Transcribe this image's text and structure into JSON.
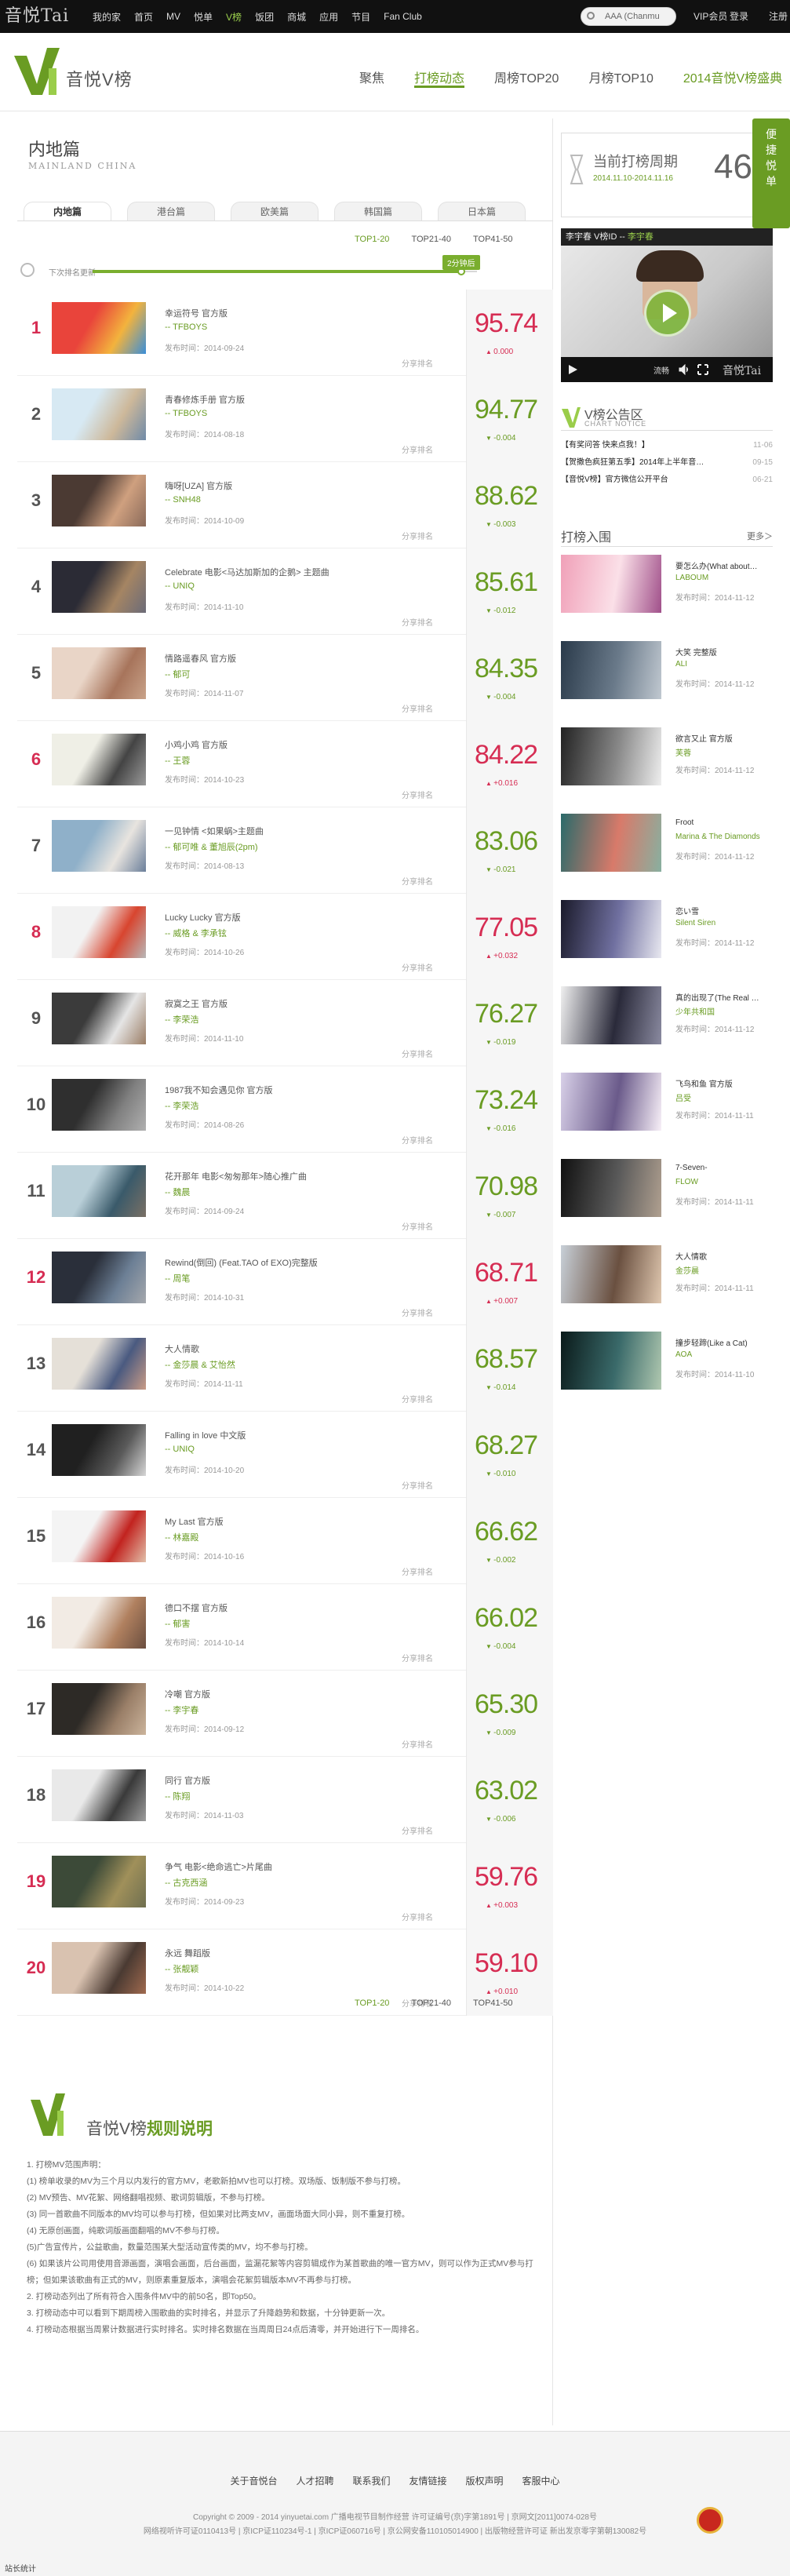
{
  "topbar": {
    "logo": "音悦Tai",
    "nav": [
      "我的家",
      "首页",
      "MV",
      "悦单",
      "V榜",
      "饭团",
      "商城",
      "应用",
      "节目",
      "Fan Club"
    ],
    "active": "V榜",
    "search_placeholder": "AAA (Chanmu",
    "vip": "VIP会员",
    "login": "登录",
    "register": "注册"
  },
  "header": {
    "title": "音悦V榜",
    "nav": [
      "聚焦",
      "打榜动态",
      "周榜TOP20",
      "月榜TOP10",
      "2014音悦V榜盛典"
    ],
    "active": "打榜动态"
  },
  "region": {
    "cn": "内地篇",
    "en": "MAINLAND CHINA"
  },
  "tabs": [
    "内地篇",
    "港台篇",
    "欧美篇",
    "韩国篇",
    "日本篇"
  ],
  "rank_tabs": [
    "TOP1-20",
    "TOP21-40",
    "TOP41-50"
  ],
  "countdown": {
    "label": "下次排名更新",
    "badge": "2分钟后",
    "progress": 0.96
  },
  "accent": "#6a9c23",
  "rise_color": "#d62d53",
  "chart": [
    {
      "rank": "1",
      "song": "幸运符号 官方版",
      "artist": "-- TFBOYS",
      "date": "发布时间：2014-09-24",
      "score": "95.74",
      "delta": "0.000",
      "dir": "up"
    },
    {
      "rank": "2",
      "song": "青春修炼手册 官方版",
      "artist": "-- TFBOYS",
      "date": "发布时间：2014-08-18",
      "score": "94.77",
      "delta": "-0.004",
      "dir": "down"
    },
    {
      "rank": "3",
      "song": "嗨呀[UZA] 官方版",
      "artist": "-- SNH48",
      "date": "发布时间：2014-10-09",
      "score": "88.62",
      "delta": "-0.003",
      "dir": "down"
    },
    {
      "rank": "4",
      "song": "Celebrate 电影<马达加斯加的企鹅> 主题曲",
      "artist": "-- UNIQ",
      "date": "发布时间：2014-11-10",
      "score": "85.61",
      "delta": "-0.012",
      "dir": "down"
    },
    {
      "rank": "5",
      "song": "情路遥春风 官方版",
      "artist": "-- 郁可",
      "date": "发布时间：2014-11-07",
      "score": "84.35",
      "delta": "-0.004",
      "dir": "down"
    },
    {
      "rank": "6",
      "song": "小鸡小鸡 官方版",
      "artist": "-- 王蓉",
      "date": "发布时间：2014-10-23",
      "score": "84.22",
      "delta": "+0.016",
      "dir": "up"
    },
    {
      "rank": "7",
      "song": "一见钟情 <如果蜗>主题曲",
      "artist": "-- 郁可唯 & 董旭辰(2pm)",
      "date": "发布时间：2014-08-13",
      "score": "83.06",
      "delta": "-0.021",
      "dir": "down"
    },
    {
      "rank": "8",
      "song": "Lucky Lucky 官方版",
      "artist": "-- 威格 & 李承铉",
      "date": "发布时间：2014-10-26",
      "score": "77.05",
      "delta": "+0.032",
      "dir": "up"
    },
    {
      "rank": "9",
      "song": "寂寞之王 官方版",
      "artist": "-- 李荣浩",
      "date": "发布时间：2014-11-10",
      "score": "76.27",
      "delta": "-0.019",
      "dir": "down"
    },
    {
      "rank": "10",
      "song": "1987我不知会遇见你 官方版",
      "artist": "-- 李荣浩",
      "date": "发布时间：2014-08-26",
      "score": "73.24",
      "delta": "-0.016",
      "dir": "down"
    },
    {
      "rank": "11",
      "song": "花开那年 电影<匆匆那年>随心推广曲",
      "artist": "-- 魏晨",
      "date": "发布时间：2014-09-24",
      "score": "70.98",
      "delta": "-0.007",
      "dir": "down"
    },
    {
      "rank": "12",
      "song": "Rewind(倒回) (Feat.TAO of EXO)完整版",
      "artist": "-- 周笔",
      "date": "发布时间：2014-10-31",
      "score": "68.71",
      "delta": "+0.007",
      "dir": "up"
    },
    {
      "rank": "13",
      "song": "大人情歌",
      "artist": "-- 金莎晨 & 艾怡然",
      "date": "发布时间：2014-11-11",
      "score": "68.57",
      "delta": "-0.014",
      "dir": "down"
    },
    {
      "rank": "14",
      "song": "Falling in love 中文版",
      "artist": "-- UNIQ",
      "date": "发布时间：2014-10-20",
      "score": "68.27",
      "delta": "-0.010",
      "dir": "down"
    },
    {
      "rank": "15",
      "song": "My Last 官方版",
      "artist": "-- 林嘉殿",
      "date": "发布时间：2014-10-16",
      "score": "66.62",
      "delta": "-0.002",
      "dir": "down"
    },
    {
      "rank": "16",
      "song": "德口不摆 官方版",
      "artist": "-- 郁害",
      "date": "发布时间：2014-10-14",
      "score": "66.02",
      "delta": "-0.004",
      "dir": "down"
    },
    {
      "rank": "17",
      "song": "冷嘲 官方版",
      "artist": "-- 李宇春",
      "date": "发布时间：2014-09-12",
      "score": "65.30",
      "delta": "-0.009",
      "dir": "down"
    },
    {
      "rank": "18",
      "song": "同行 官方版",
      "artist": "-- 陈翔",
      "date": "发布时间：2014-11-03",
      "score": "63.02",
      "delta": "-0.006",
      "dir": "down"
    },
    {
      "rank": "19",
      "song": "争气 电影<绝命逃亡>片尾曲",
      "artist": "-- 古克西涵",
      "date": "发布时间：2014-09-23",
      "score": "59.76",
      "delta": "+0.003",
      "dir": "up"
    },
    {
      "rank": "20",
      "song": "永远 舞蹈版",
      "artist": "-- 张靓颖",
      "date": "发布时间：2014-10-22",
      "score": "59.10",
      "delta": "+0.010",
      "dir": "up"
    }
  ],
  "share_label": "分享排名",
  "rules": {
    "title_a": "音悦V榜",
    "title_b": "规则说明",
    "lines": [
      "1. 打榜MV范围声明：",
      "(1) 榜单收录的MV为三个月以内发行的官方MV，老歌新拍MV也可以打榜。双场版、饭制版不参与打榜。",
      "(2) MV预告、MV花絮、网络翻唱视频、歌词剪辑版，不参与打榜。",
      "(3) 同一首歌曲不同版本的MV均可以参与打榜，但如果对比两支MV，画面场面大同小异，则不重复打榜。",
      "(4) 无原创画面，纯歌词版画面翻唱的MV不参与打榜。",
      "(5)广告宣传片，公益歌曲，数量范围某大型活动宣传类的MV，均不参与打榜。",
      "(6) 如果该片公司用使用音源画面，演唱会画面，后台画面，监漏花絮等内容剪辑成作为某首歌曲的唯一官方MV，则可以作为正式MV参与打榜；但如果该歌曲有正式的MV，则原素重复版本，演唱会花絮剪辑版本MV不再参与打榜。",
      "2. 打榜动态列出了所有符合入围条件MV中的前50名，即Top50。",
      "3. 打榜动态中可以看到下期周榜入围歌曲的实时排名，并显示了升降趋势和数据，十分钟更新一次。",
      "4. 打榜动态根据当周累计数据进行实时排名。实时排名数据在当周周日24点后清零，并开始进行下一周排名。"
    ]
  },
  "sidebar": {
    "quick": "便捷悦单",
    "period_label": "当前打榜周期",
    "period_dates": "2014.11.10-2014.11.16",
    "period_num": "46",
    "player_title": "李宇春 V榜ID -- ",
    "player_artist": "李宇春",
    "player_label": "流畅",
    "notice_title": "V榜公告区",
    "notice_sub": "CHART NOTICE",
    "notices": [
      {
        "t": "【有奖问答 快来点我！】",
        "d": "11-06"
      },
      {
        "t": "【贺撒色疯狂第五季】2014年上半年音…",
        "d": "09-15"
      },
      {
        "t": "【音悦V榜】官方微信公开平台",
        "d": "06-21"
      }
    ],
    "list_title": "打榜入围",
    "more": "更多＞",
    "items": [
      {
        "t": "要怎么办(What about…",
        "a": "LABOUM",
        "d": "发布时间：2014-11-12"
      },
      {
        "t": "大笑 完整版",
        "a": "ALI",
        "d": "发布时间：2014-11-12"
      },
      {
        "t": "欲言又止 官方版",
        "a": "芙蓉",
        "d": "发布时间：2014-11-12"
      },
      {
        "t": "Froot",
        "a": "Marina & The Diamonds",
        "d": "发布时间：2014-11-12"
      },
      {
        "t": "恋い雪",
        "a": "Silent Siren",
        "d": "发布时间：2014-11-12"
      },
      {
        "t": "真的出现了(The Real …",
        "a": "少年共和国",
        "d": "发布时间：2014-11-12"
      },
      {
        "t": "飞鸟和鱼 官方版",
        "a": "吕受",
        "d": "发布时间：2014-11-11"
      },
      {
        "t": "7-Seven-",
        "a": "FLOW",
        "d": "发布时间：2014-11-11"
      },
      {
        "t": "大人情歌",
        "a": "金莎晨",
        "d": "发布时间：2014-11-11"
      },
      {
        "t": "撞步轻蹄(Like a Cat)",
        "a": "AOA",
        "d": "发布时间：2014-11-10"
      }
    ]
  },
  "footer": {
    "links": [
      "关于音悦台",
      "人才招聘",
      "联系我们",
      "友情链接",
      "版权声明",
      "客服中心"
    ],
    "line1": "Copyright © 2009 - 2014 yinyuetai.com 广播电视节目制作经营 许可证编号(京)字第1891号 | 京网文[2011]0074-028号",
    "line2": "网络视听许可证0110413号 | 京ICP证110234号-1 | 京ICP证060716号 | 京公网安备110105014900 | 出版物经营许可证 新出发京零字第朝130082号",
    "stats": "站长统计"
  }
}
